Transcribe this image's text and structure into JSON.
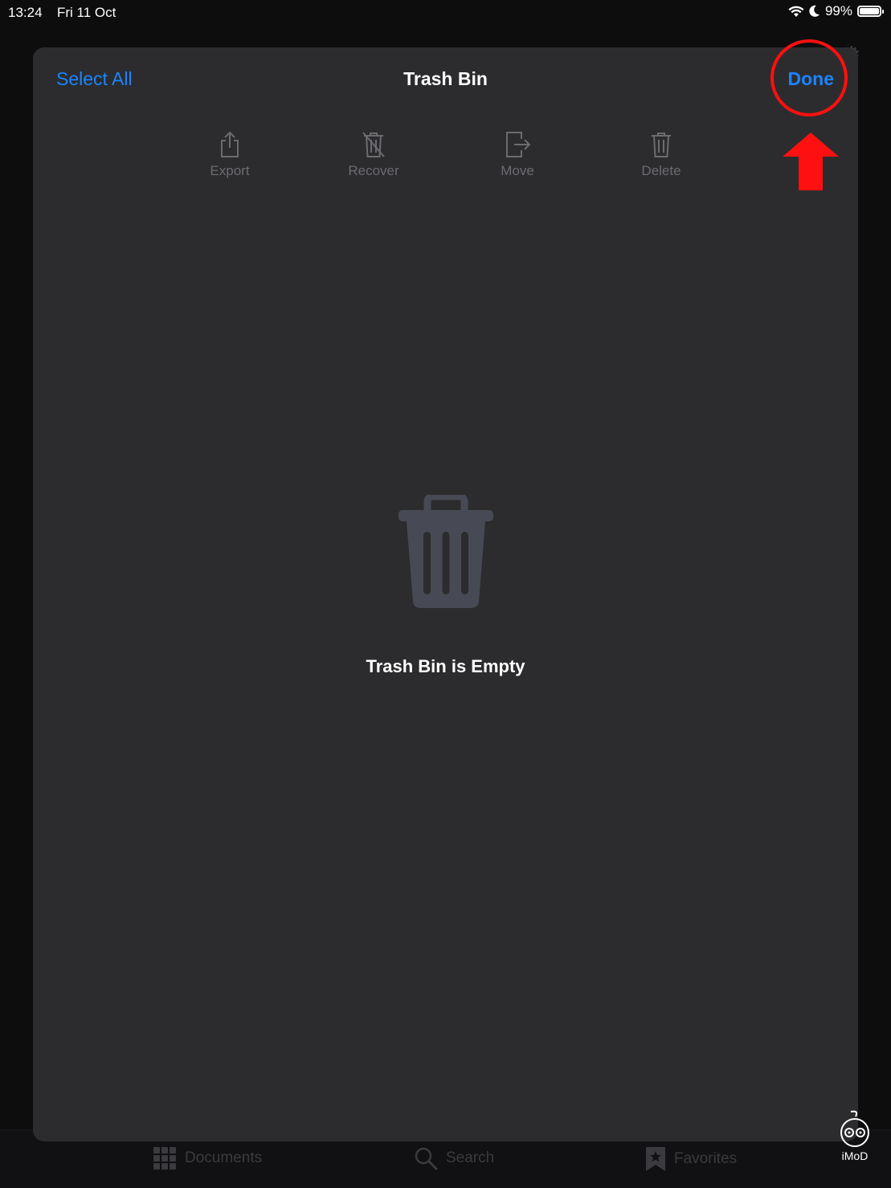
{
  "status_bar": {
    "time": "13:24",
    "date": "Fri 11 Oct",
    "battery": "99%",
    "battery_level": 0.99
  },
  "modal": {
    "select_all_label": "Select All",
    "title": "Trash Bin",
    "done_label": "Done",
    "toolbar": {
      "export_label": "Export",
      "recover_label": "Recover",
      "move_label": "Move",
      "delete_label": "Delete"
    },
    "empty_message": "Trash Bin is Empty"
  },
  "tab_bar": {
    "documents_label": "Documents",
    "search_label": "Search",
    "favorites_label": "Favorites"
  },
  "watermark": {
    "text": "iMoD"
  },
  "colors": {
    "accent": "#1b84ff",
    "annotation": "#ff1010",
    "modal_background": "#2c2c2e"
  }
}
